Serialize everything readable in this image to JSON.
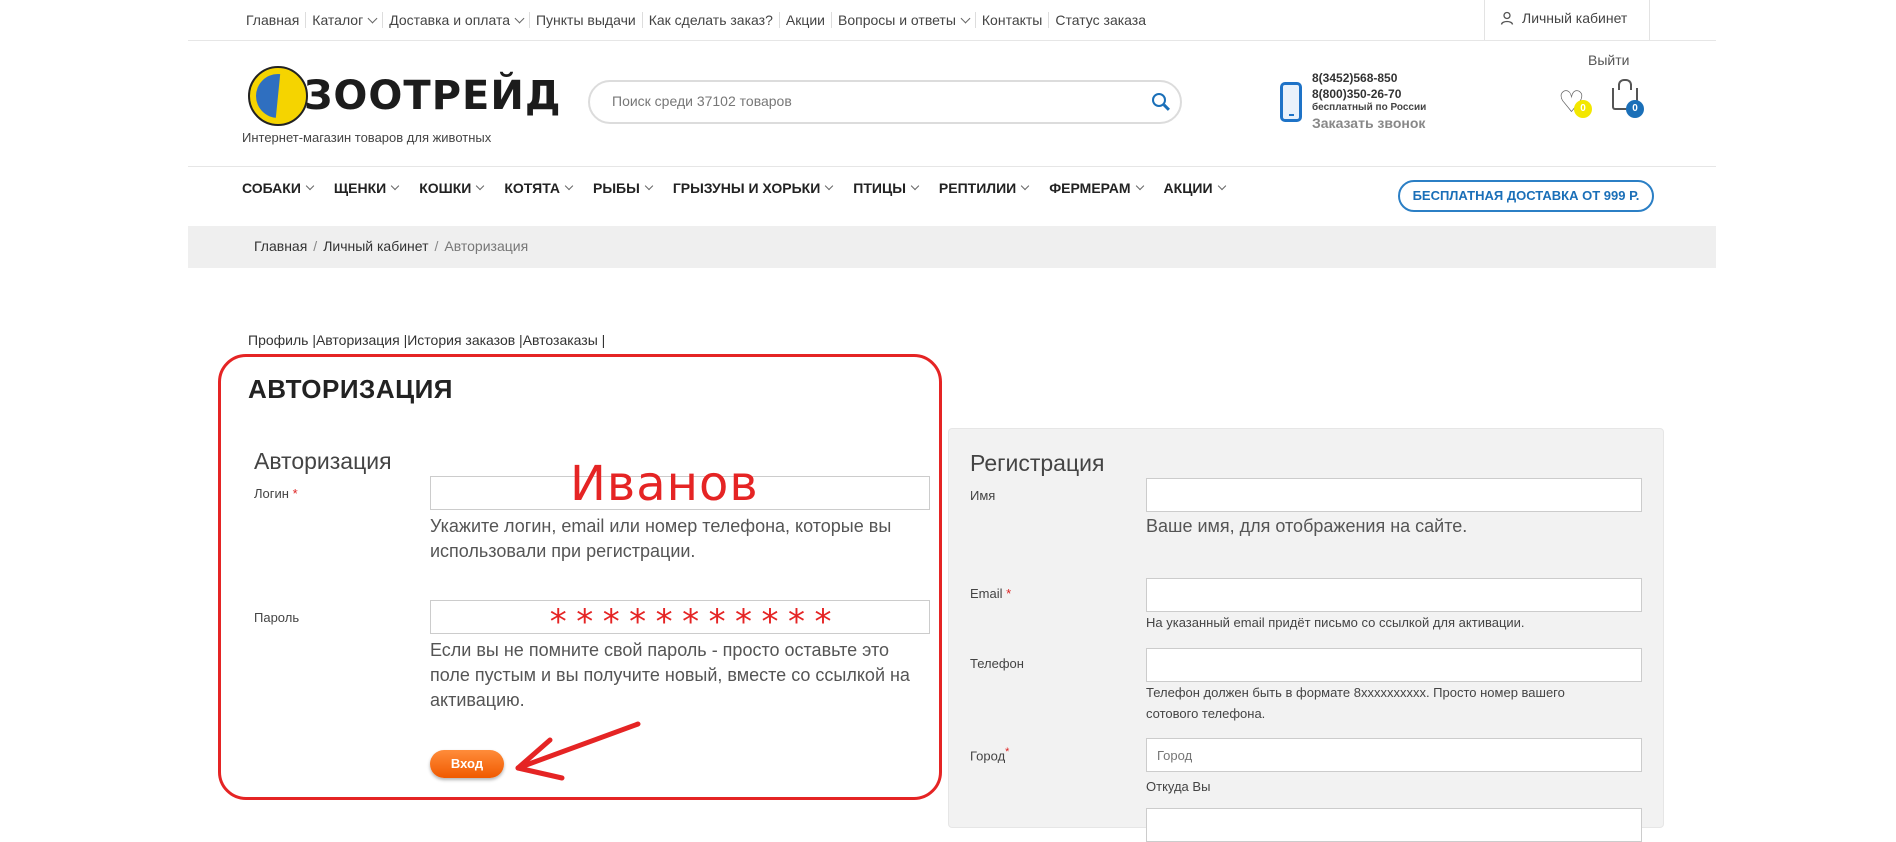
{
  "topnav": {
    "items": [
      {
        "label": "Главная",
        "has_dropdown": false
      },
      {
        "label": "Каталог",
        "has_dropdown": true
      },
      {
        "label": "Доставка и оплата",
        "has_dropdown": true
      },
      {
        "label": "Пункты выдачи",
        "has_dropdown": false
      },
      {
        "label": "Как сделать заказ?",
        "has_dropdown": false
      },
      {
        "label": "Акции",
        "has_dropdown": false
      },
      {
        "label": "Вопросы и ответы",
        "has_dropdown": true
      },
      {
        "label": "Контакты",
        "has_dropdown": false
      },
      {
        "label": "Статус заказа",
        "has_dropdown": false
      }
    ],
    "cabinet": "Личный кабинет",
    "logout": "Выйти"
  },
  "header": {
    "logo_text": "ЗООТРЕЙД",
    "tagline": "Интернет-магазин товаров для животных",
    "search_placeholder": "Поиск среди 37102 товаров",
    "phone1": "8(3452)568-850",
    "phone2": "8(800)350-26-70",
    "phone_note": "бесплатный по России",
    "callback": "Заказать звонок",
    "wishlist_count": "0",
    "cart_count": "0"
  },
  "mainnav": {
    "items": [
      "СОБАКИ",
      "ЩЕНКИ",
      "КОШКИ",
      "КОТЯТА",
      "РЫБЫ",
      "ГРЫЗУНЫ И ХОРЬКИ",
      "ПТИЦЫ",
      "РЕПТИЛИИ",
      "ФЕРМЕРАМ",
      "АКЦИИ"
    ],
    "free_shipping": "БЕСПЛАТНАЯ ДОСТАВКА ОТ 999 Р."
  },
  "breadcrumb": {
    "items": [
      "Главная",
      "Личный кабинет"
    ],
    "current": "Авторизация"
  },
  "profile_tabs": "Профиль |Авторизация |История заказов |Автозаказы |",
  "auth": {
    "page_title": "АВТОРИЗАЦИЯ",
    "section_title": "Авторизация",
    "login_label": "Логин",
    "login_value": "Иванов",
    "login_hint": "Укажите логин, email или номер телефона, которые вы использовали при регистрации.",
    "password_label": "Пароль",
    "password_mask": "***********",
    "password_hint": "Если вы не помните свой пароль - просто оставьте это поле пустым и вы получите новый, вместе со ссылкой на активацию.",
    "submit": "Вход"
  },
  "registration": {
    "section_title": "Регистрация",
    "name_label": "Имя",
    "name_hint": "Ваше имя, для отображения на сайте.",
    "email_label": "Email",
    "email_hint": "На указанный email придёт письмо со ссылкой для активации.",
    "phone_label": "Телефон",
    "phone_hint": "Телефон должен быть в формате 8xxxxxxxxxx. Просто номер вашего сотового телефона.",
    "city_label": "Город",
    "city_placeholder": "Город",
    "city_hint": "Откуда Вы"
  },
  "colors": {
    "accent_blue": "#1a6fb8",
    "annotation_red": "#e52424",
    "button_orange": "#f26a0c"
  }
}
